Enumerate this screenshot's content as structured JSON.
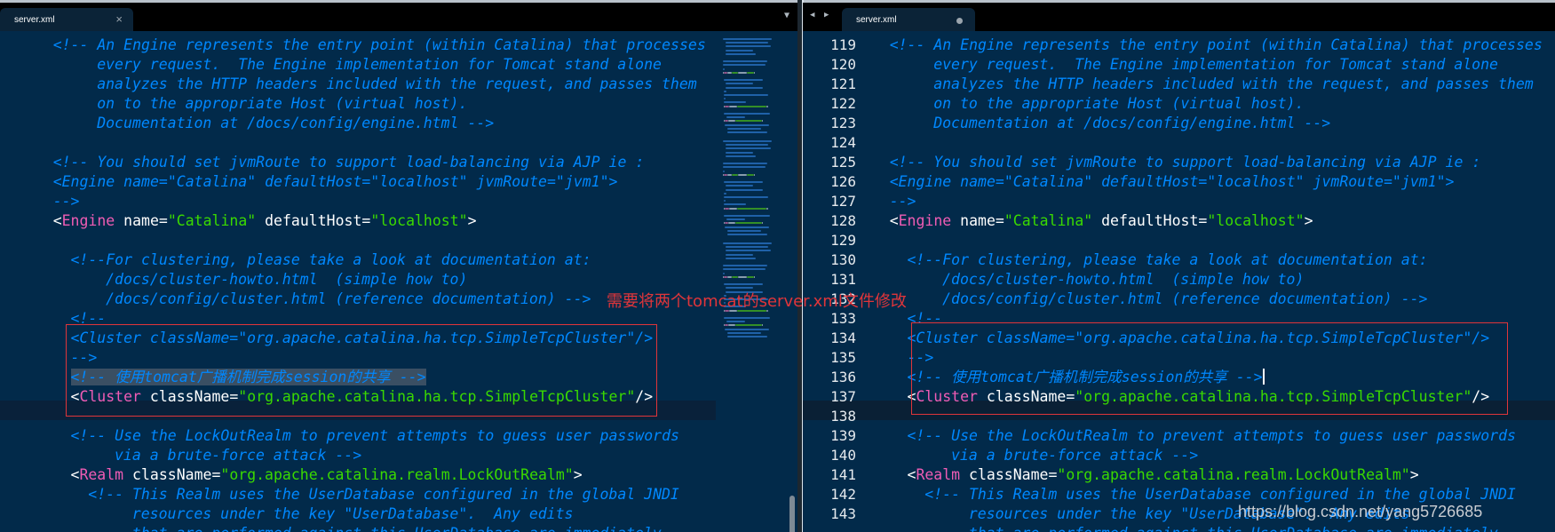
{
  "left_pane": {
    "tab": {
      "title": "server.xml",
      "close_icon": "×"
    },
    "tab_menu_icon": "▼"
  },
  "right_pane": {
    "tab": {
      "title": "server.xml",
      "modified_icon": "●"
    },
    "nav_back_icon": "◀",
    "nav_forward_icon": "▶"
  },
  "colors": {
    "background": "#022a4a",
    "comment": "#0088ff",
    "tag": "#f05cb4",
    "string": "#3ad900",
    "annotation": "#e0353a"
  },
  "code_lines": [
    {
      "number": "119",
      "indent": 3,
      "tokens": [
        [
          "cm",
          "<!-- An Engine represents the entry point (within Catalina) that processes"
        ]
      ]
    },
    {
      "number": "120",
      "indent": 8,
      "tokens": [
        [
          "cm",
          "every request.  The Engine implementation for Tomcat stand alone"
        ]
      ]
    },
    {
      "number": "121",
      "indent": 8,
      "tokens": [
        [
          "cm",
          "analyzes the HTTP headers included with the request, and passes them"
        ]
      ]
    },
    {
      "number": "122",
      "indent": 8,
      "tokens": [
        [
          "cm",
          "on to the appropriate Host (virtual host)."
        ]
      ]
    },
    {
      "number": "123",
      "indent": 8,
      "tokens": [
        [
          "cm",
          "Documentation at /docs/config/engine.html -->"
        ]
      ]
    },
    {
      "number": "124",
      "indent": 0,
      "tokens": []
    },
    {
      "number": "125",
      "indent": 3,
      "tokens": [
        [
          "cm",
          "<!-- You should set jvmRoute to support load-balancing via AJP ie :"
        ]
      ]
    },
    {
      "number": "126",
      "indent": 3,
      "tokens": [
        [
          "cm",
          "<Engine name=\"Catalina\" defaultHost=\"localhost\" jvmRoute=\"jvm1\">"
        ]
      ]
    },
    {
      "number": "127",
      "indent": 3,
      "tokens": [
        [
          "cm",
          "-->"
        ]
      ]
    },
    {
      "number": "128",
      "indent": 3,
      "tokens": [
        [
          "pl",
          "<"
        ],
        [
          "tg",
          "Engine"
        ],
        [
          "at",
          " name="
        ],
        [
          "st",
          "\"Catalina\""
        ],
        [
          "at",
          " defaultHost="
        ],
        [
          "st",
          "\"localhost\""
        ],
        [
          "pl",
          ">"
        ]
      ]
    },
    {
      "number": "129",
      "indent": 0,
      "tokens": []
    },
    {
      "number": "130",
      "indent": 5,
      "tokens": [
        [
          "cm",
          "<!--For clustering, please take a look at documentation at:"
        ]
      ]
    },
    {
      "number": "131",
      "indent": 9,
      "tokens": [
        [
          "cm",
          "/docs/cluster-howto.html  (simple how to)"
        ]
      ]
    },
    {
      "number": "132",
      "indent": 9,
      "tokens": [
        [
          "cm",
          "/docs/config/cluster.html (reference documentation) -->"
        ]
      ]
    },
    {
      "number": "133",
      "indent": 5,
      "tokens": [
        [
          "cm",
          "<!--"
        ]
      ]
    },
    {
      "number": "134",
      "indent": 5,
      "tokens": [
        [
          "cm",
          "<Cluster className=\"org.apache.catalina.ha.tcp.SimpleTcpCluster\"/>"
        ]
      ]
    },
    {
      "number": "135",
      "indent": 5,
      "tokens": [
        [
          "cm",
          "-->"
        ]
      ]
    },
    {
      "number": "136",
      "indent": 5,
      "tokens": [
        [
          "cm",
          "<!-- 使用tomcat广播机制完成session的共享 -->"
        ]
      ]
    },
    {
      "number": "137",
      "indent": 5,
      "tokens": [
        [
          "pl",
          "<"
        ],
        [
          "tg",
          "Cluster"
        ],
        [
          "at",
          " className="
        ],
        [
          "st",
          "\"org.apache.catalina.ha.tcp.SimpleTcpCluster\""
        ],
        [
          "pl",
          "/>"
        ]
      ]
    },
    {
      "number": "138",
      "indent": 0,
      "tokens": []
    },
    {
      "number": "139",
      "indent": 5,
      "tokens": [
        [
          "cm",
          "<!-- Use the LockOutRealm to prevent attempts to guess user passwords"
        ]
      ]
    },
    {
      "number": "140",
      "indent": 10,
      "tokens": [
        [
          "cm",
          "via a brute-force attack -->"
        ]
      ]
    },
    {
      "number": "141",
      "indent": 5,
      "tokens": [
        [
          "pl",
          "<"
        ],
        [
          "tg",
          "Realm"
        ],
        [
          "at",
          " className="
        ],
        [
          "st",
          "\"org.apache.catalina.realm.LockOutRealm\""
        ],
        [
          "pl",
          ">"
        ]
      ]
    },
    {
      "number": "142",
      "indent": 7,
      "tokens": [
        [
          "cm",
          "<!-- This Realm uses the UserDatabase configured in the global JNDI"
        ]
      ]
    },
    {
      "number": "143",
      "indent": 12,
      "tokens": [
        [
          "cm",
          "resources under the key \"UserDatabase\".  Any edits"
        ]
      ]
    },
    {
      "number": "",
      "indent": 12,
      "tokens": [
        [
          "cm",
          "that are performed against this UserDatabase are immediately"
        ]
      ]
    }
  ],
  "annotation_text": "需要将两个tomcat的server.xml文件修改",
  "watermark": "https://blog.csdn.net/yang5726685"
}
